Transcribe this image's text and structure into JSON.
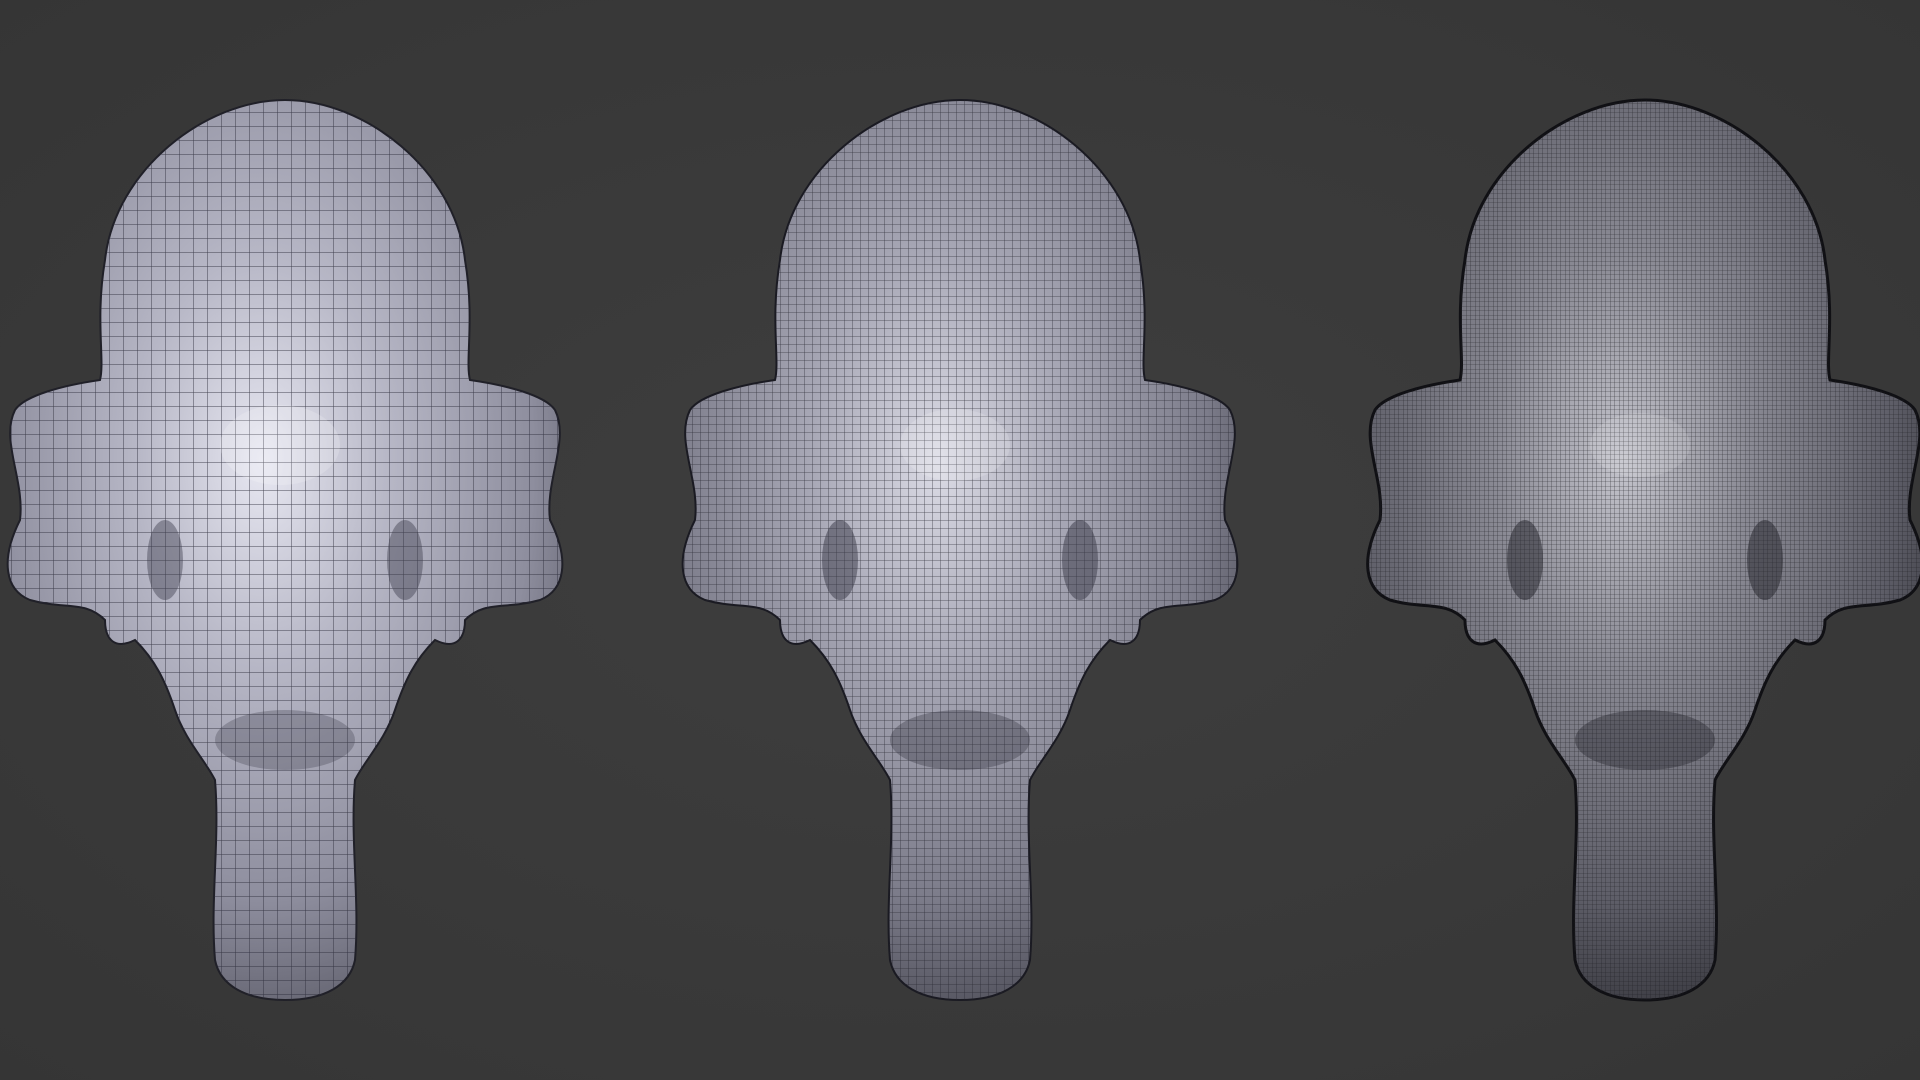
{
  "scene": {
    "background_color": "#3a3a3a",
    "subject": "elephant-head-wireframe",
    "models": [
      {
        "label": "",
        "mesh_density": "low",
        "surface_color": "#b9b9c6",
        "wire_color": "#2a2a38"
      },
      {
        "label": "",
        "mesh_density": "medium",
        "surface_color": "#a9a9b6",
        "wire_color": "#24242e"
      },
      {
        "label": "",
        "mesh_density": "high",
        "surface_color": "#8b8b94",
        "wire_color": "#1e1e24"
      }
    ]
  }
}
